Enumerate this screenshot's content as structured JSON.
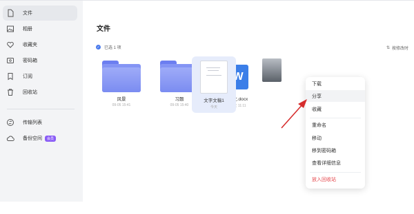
{
  "sidebar": {
    "items": [
      {
        "label": "文件",
        "icon": "file-icon",
        "active": true
      },
      {
        "label": "相册",
        "icon": "photo-icon"
      },
      {
        "label": "收藏夹",
        "icon": "heart-icon"
      },
      {
        "label": "密码箱",
        "icon": "safe-icon"
      },
      {
        "label": "订阅",
        "icon": "bookmark-icon"
      },
      {
        "label": "回收站",
        "icon": "trash-icon"
      },
      {
        "label": "传输列表",
        "icon": "transfer-icon"
      },
      {
        "label": "备份空间",
        "icon": "cloud-icon",
        "badge": "会员"
      }
    ]
  },
  "main": {
    "title": "文件",
    "selection": "已选 1 项",
    "sort_label": "按修改时",
    "files": [
      {
        "name": "风景",
        "date": "09-05 15:41",
        "type": "folder"
      },
      {
        "name": "习题",
        "date": "09-05 15:40",
        "type": "folder"
      },
      {
        "name": "散文.docx",
        "date": "今天 11:11",
        "type": "word"
      },
      {
        "name": "文字文稿1",
        "date": "今天",
        "type": "txt"
      },
      {
        "name": "",
        "date": "",
        "type": "image"
      }
    ]
  },
  "context_menu": {
    "items": [
      "下载",
      "分享",
      "收藏",
      "重命名",
      "移动",
      "移到密码箱",
      "查看详细信息",
      "放入回收站"
    ]
  },
  "colors": {
    "accent": "#4b7bec",
    "danger": "#e5484d",
    "arrow": "#d62d2d"
  }
}
